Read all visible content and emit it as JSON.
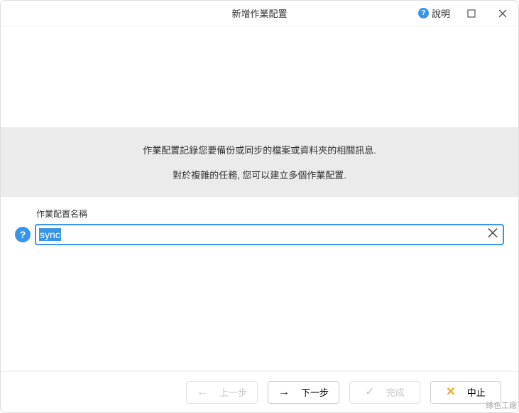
{
  "titlebar": {
    "title": "新增作業配置",
    "help_label": "說明"
  },
  "banner": {
    "line1": "作業配置記錄您要備份或同步的檔案或資料夾的相關訊息.",
    "line2": "對於複雜的任務, 您可以建立多個作業配置."
  },
  "form": {
    "label": "作業配置名稱",
    "value": "sync"
  },
  "footer": {
    "back": "上一步",
    "next": "下一步",
    "finish": "完成",
    "cancel": "中止"
  },
  "watermark": "綠色工廠"
}
